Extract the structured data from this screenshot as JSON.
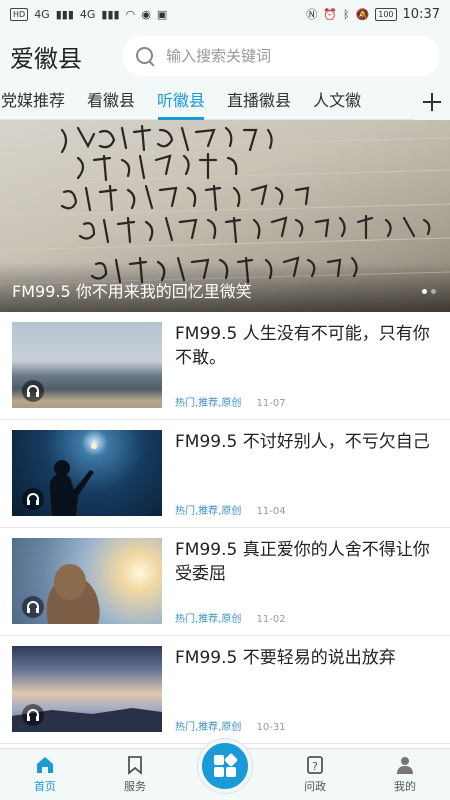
{
  "status_bar": {
    "left_chip": "HD",
    "signal_1": "4G",
    "signal_2": "4G",
    "battery": "100",
    "time": "10:37"
  },
  "header": {
    "app_title": "爱徽县",
    "search_placeholder": "输入搜索关键词"
  },
  "tabs": [
    "党媒推荐",
    "看徽县",
    "听徽县",
    "直播徽县",
    "人文徽"
  ],
  "active_tab_index": 2,
  "banner": {
    "caption": "FM99.5 你不用来我的回忆里微笑",
    "slide_count": 2,
    "active_slide": 0
  },
  "articles": [
    {
      "title": "FM99.5 人生没有不可能，只有你不敢。",
      "tags": "热门,推荐,原创",
      "date": "11-07"
    },
    {
      "title": "FM99.5 不讨好别人，不亏欠自己",
      "tags": "热门,推荐,原创",
      "date": "11-04"
    },
    {
      "title": "FM99.5 真正爱你的人舍不得让你受委屈",
      "tags": "热门,推荐,原创",
      "date": "11-02"
    },
    {
      "title": "FM99.5 不要轻易的说出放弃",
      "tags": "热门,推荐,原创",
      "date": "10-31"
    }
  ],
  "bottom_nav": {
    "home": "首页",
    "service": "服务",
    "politics": "问政",
    "mine": "我的"
  },
  "colors": {
    "accent": "#1a9bd7",
    "tag": "#3a8fc4",
    "bar_bg": "#f3f8f8"
  }
}
